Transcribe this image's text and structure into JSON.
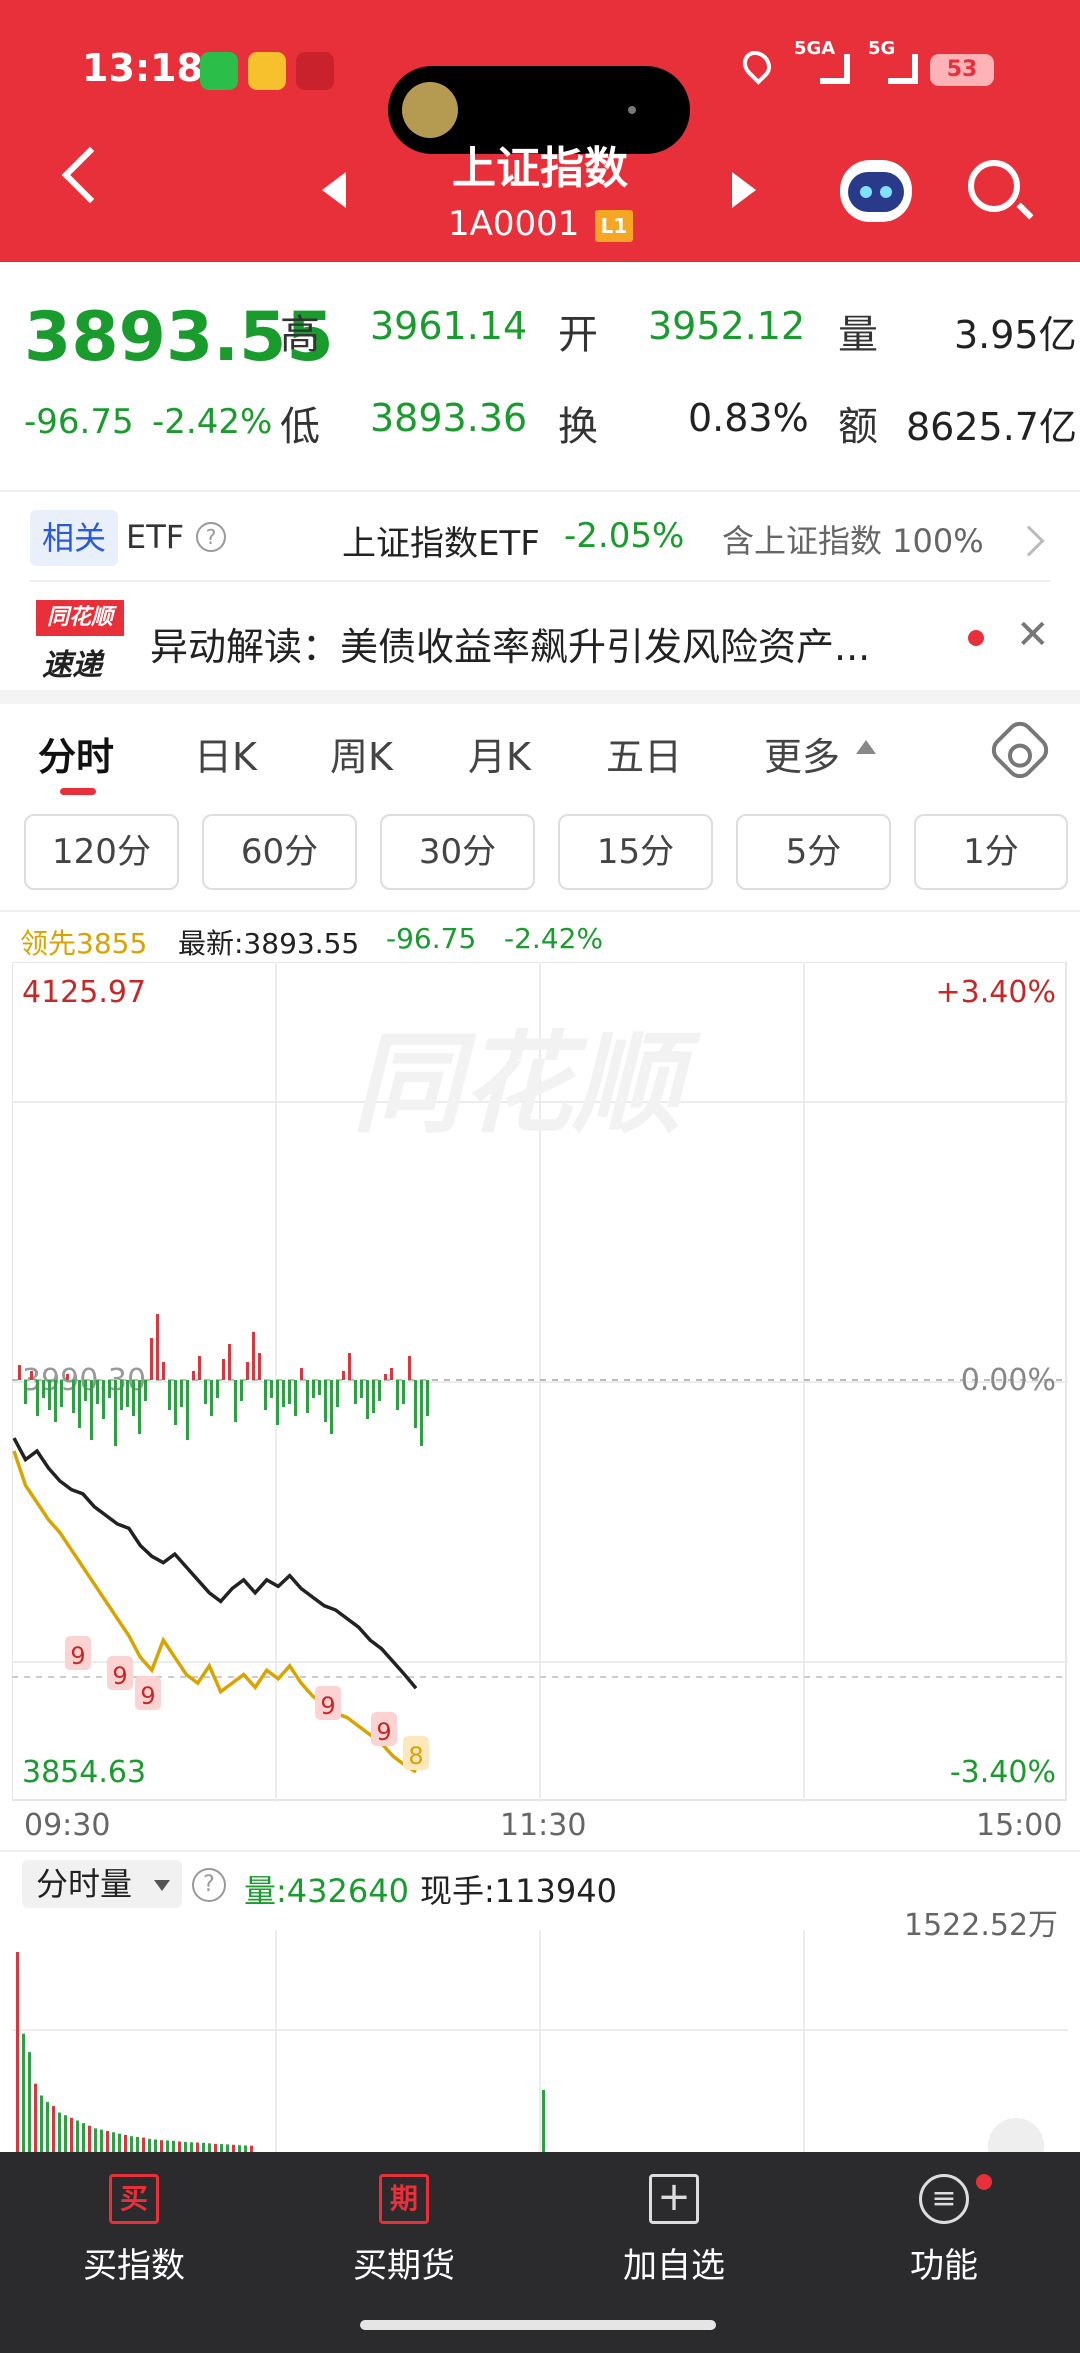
{
  "status_bar": {
    "time": "13:18",
    "signal1": "5GA",
    "signal2": "5G",
    "battery": "53"
  },
  "header": {
    "title": "上证指数",
    "code": "1A0001",
    "level": "L1"
  },
  "quote": {
    "price": "3893.55",
    "change": "-96.75",
    "change_pct": "-2.42%",
    "high_label": "高",
    "high": "3961.14",
    "open_label": "开",
    "open": "3952.12",
    "volume_label": "量",
    "volume": "3.95亿",
    "low_label": "低",
    "low": "3893.36",
    "turnover_label": "换",
    "turnover": "0.83%",
    "amount_label": "额",
    "amount": "8625.7亿"
  },
  "related": {
    "tag": "相关",
    "etf": "ETF",
    "help": "?",
    "name": "上证指数ETF",
    "change": "-2.05%",
    "note": "含上证指数 100%"
  },
  "news": {
    "logo_top": "同花顺",
    "logo_bottom": "速递",
    "text": "异动解读：美债收益率飙升引发风险资产...",
    "close": "✕"
  },
  "tabs": [
    {
      "label": "分时"
    },
    {
      "label": "日K"
    },
    {
      "label": "周K"
    },
    {
      "label": "月K"
    },
    {
      "label": "五日"
    },
    {
      "label": "更多"
    }
  ],
  "periods": [
    "120分",
    "60分",
    "30分",
    "15分",
    "5分",
    "1分"
  ],
  "chart_info": {
    "lead_label": "领先3855",
    "latest": "最新:3893.55",
    "change": "-96.75",
    "change_pct": "-2.42%"
  },
  "colors": {
    "red": "#e8303a",
    "green": "#1a9b2e",
    "gold": "#d9a300",
    "line": "#222222"
  },
  "chart_data": {
    "type": "line",
    "y_max_label": "4125.97",
    "y_min_label": "3854.63",
    "pct_max_label": "+3.40%",
    "pct_zero_label": "0.00%",
    "pct_min_label": "-3.40%",
    "mid_price_label": "3990.30",
    "watermark": "同花顺",
    "ylim": [
      3854.63,
      4125.97
    ],
    "prev_close": 3990.3,
    "x_ticks": [
      "09:30",
      "11:30",
      "15:00"
    ],
    "series": [
      {
        "values": [
          4010,
          4000,
          4004,
          3996,
          3990,
          3986,
          3984,
          3978,
          3974,
          3970,
          3968,
          3960,
          3955,
          3952,
          3956,
          3950,
          3944,
          3938,
          3934,
          3940,
          3944,
          3938,
          3944,
          3941,
          3946,
          3940,
          3936,
          3932,
          3930,
          3926,
          3922,
          3916,
          3912,
          3906,
          3900,
          3893.55
        ]
      },
      {
        "values": [
          4004,
          3988,
          3980,
          3972,
          3966,
          3958,
          3950,
          3942,
          3934,
          3926,
          3918,
          3908,
          3902,
          3916,
          3908,
          3900,
          3896,
          3904,
          3892,
          3896,
          3900,
          3894,
          3902,
          3898,
          3904,
          3896,
          3890,
          3886,
          3882,
          3880,
          3876,
          3872,
          3868,
          3862,
          3858,
          3854.63
        ]
      }
    ],
    "signal_markers": [
      "9",
      "9",
      "9",
      "9",
      "9",
      "8"
    ],
    "bars": [
      5,
      -8,
      3,
      -12,
      -6,
      -10,
      -14,
      -9,
      2,
      -11,
      -16,
      -7,
      -20,
      -8,
      -13,
      -6,
      -22,
      -10,
      -9,
      -12,
      -18,
      -7,
      14,
      22,
      6,
      -10,
      -15,
      -9,
      -20,
      3,
      8,
      -8,
      -12,
      -6,
      7,
      12,
      -14,
      -7,
      6,
      16,
      9,
      -10,
      -6,
      -15,
      -9,
      -8,
      -12,
      4,
      -11,
      -6,
      -5,
      -14,
      -18,
      -9,
      3,
      9,
      -8,
      -6,
      -13,
      -11,
      -7,
      2,
      4,
      -10,
      -8,
      8,
      -16,
      -22,
      -12
    ]
  },
  "volume": {
    "selector": "分时量",
    "help": "?",
    "amount": "量:432640",
    "hand": "现手:113940",
    "max_label": "1522.52万",
    "values": [
      1522,
      900,
      760,
      520,
      430,
      380,
      350,
      300,
      280,
      260,
      240,
      220,
      200,
      180,
      170,
      160,
      150,
      140,
      130,
      120,
      115,
      110,
      100,
      95,
      90,
      88,
      85,
      80,
      76,
      74,
      72,
      70,
      66,
      62,
      60,
      58,
      55,
      52,
      50,
      48
    ]
  },
  "bottom_nav": [
    {
      "icon": "买",
      "label": "买指数"
    },
    {
      "icon": "期",
      "label": "买期货"
    },
    {
      "icon": "+",
      "label": "加自选"
    },
    {
      "icon": "≡",
      "label": "功能"
    }
  ]
}
